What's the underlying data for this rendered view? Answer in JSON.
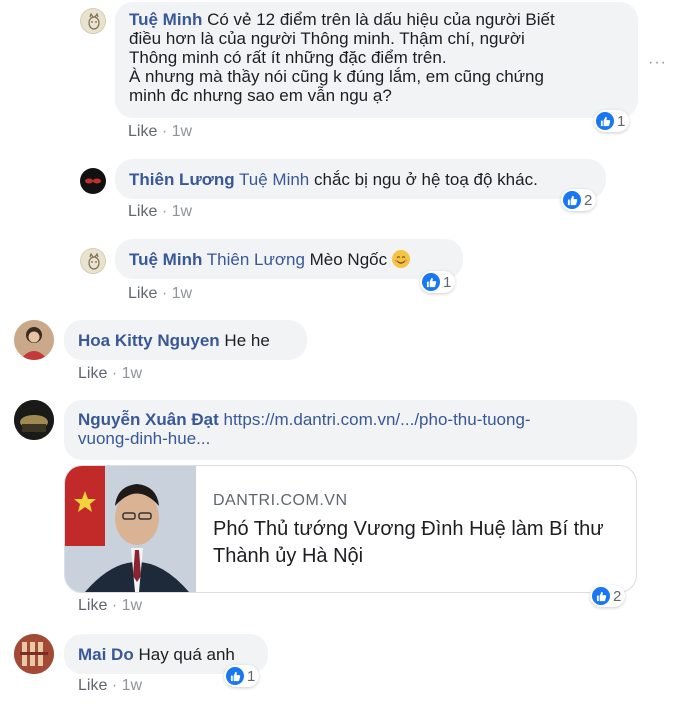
{
  "comments": [
    {
      "author": "Tuệ Minh",
      "lines": [
        "Có vẻ 12 điểm trên là dấu hiệu của người Biết",
        "điều hơn là của người Thông minh. Thậm chí, người",
        "Thông minh có rất ít những đặc điểm trên.",
        "À nhưng mà thầy nói cũng k đúng lắm, em cũng chứng",
        "minh đc nhưng sao em vẫn ngu ạ?"
      ],
      "like_label": "Like",
      "time": "1w",
      "reactions": "1"
    },
    {
      "author": "Thiên Lương",
      "mention": "Tuệ Minh",
      "text": "chắc bị ngu ở hệ toạ độ khác.",
      "like_label": "Like",
      "time": "1w",
      "reactions": "2"
    },
    {
      "author": "Tuệ Minh",
      "mention": "Thiên Lương",
      "text": "Mèo Ngốc",
      "emoji": "smiling-face-emoji",
      "like_label": "Like",
      "time": "1w",
      "reactions": "1"
    },
    {
      "author": "Hoa Kitty Nguyen",
      "text": "He he",
      "like_label": "Like",
      "time": "1w"
    },
    {
      "author": "Nguyễn Xuân Đạt",
      "link_line1": "https://m.dantri.com.vn/.../pho-thu-tuong-",
      "link_line2": "vuong-dinh-hue...",
      "preview": {
        "domain": "DANTRI.COM.VN",
        "title": "Phó Thủ tướng Vương Đình Huệ làm Bí thư Thành ủy Hà Nội"
      },
      "like_label": "Like",
      "time": "1w",
      "reactions": "2"
    },
    {
      "author": "Mai Do",
      "text": "Hay quá anh",
      "like_label": "Like",
      "time": "1w",
      "reactions": "1"
    }
  ],
  "separator": "·",
  "more_options": "···",
  "colors": {
    "link": "#385898",
    "bubble": "#f2f3f5",
    "like_blue": "#1877f2",
    "meta": "#90949c"
  }
}
